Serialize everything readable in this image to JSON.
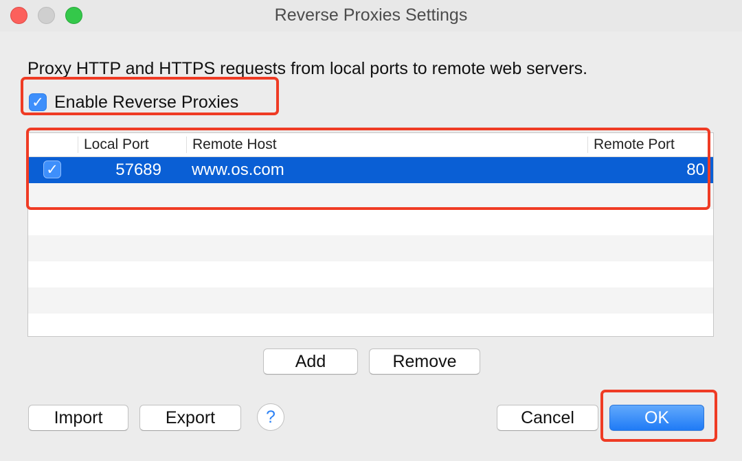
{
  "window": {
    "title": "Reverse Proxies Settings"
  },
  "description": "Proxy HTTP and HTTPS requests from local ports to remote web servers.",
  "enable": {
    "label": "Enable Reverse Proxies",
    "checked": true,
    "check_glyph": "✓"
  },
  "table": {
    "columns": {
      "local_port": "Local Port",
      "remote_host": "Remote Host",
      "remote_port": "Remote Port"
    },
    "rows": [
      {
        "enabled": true,
        "check_glyph": "✓",
        "local_port": "57689",
        "remote_host": "www.os.com",
        "remote_port": "80",
        "selected": true
      }
    ]
  },
  "buttons": {
    "add": "Add",
    "remove": "Remove",
    "import": "Import",
    "export": "Export",
    "help": "?",
    "cancel": "Cancel",
    "ok": "OK"
  },
  "colors": {
    "selection": "#0a5fd5",
    "accent": "#3e8ffb",
    "highlight": "#ef3b24"
  }
}
